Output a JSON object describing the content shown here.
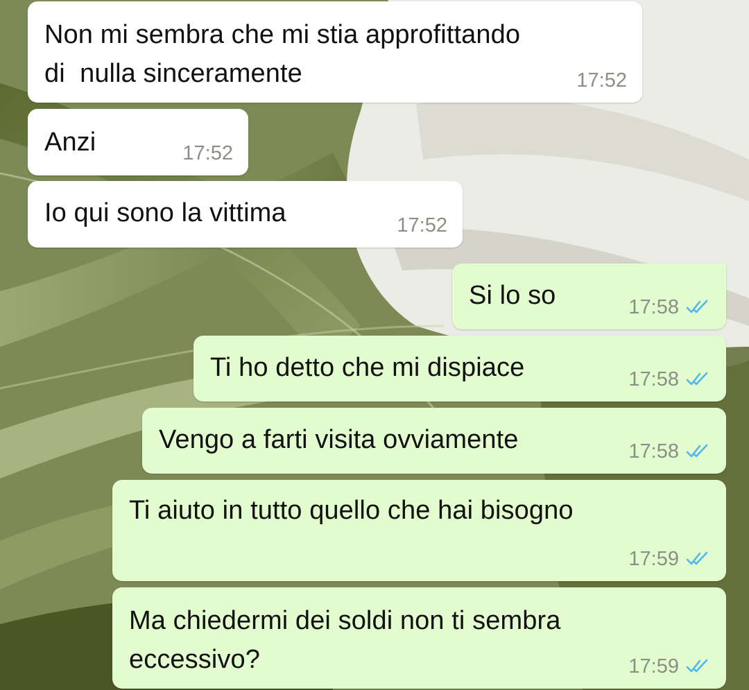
{
  "chat": {
    "messages": [
      {
        "direction": "in",
        "lines": "Non mi sembra che mi stia approfittando\ndi  nulla sinceramente",
        "time": "17:52"
      },
      {
        "direction": "in",
        "lines": "Anzi",
        "time": "17:52"
      },
      {
        "direction": "in",
        "lines": "Io qui sono la vittima",
        "time": "17:52"
      },
      {
        "direction": "out",
        "lines": "Si lo so",
        "time": "17:58",
        "status": "read"
      },
      {
        "direction": "out",
        "lines": "Ti ho detto che mi dispiace",
        "time": "17:58",
        "status": "read"
      },
      {
        "direction": "out",
        "lines": "Vengo a farti visita ovviamente",
        "time": "17:58",
        "status": "read"
      },
      {
        "direction": "out",
        "lines": "Ti aiuto in tutto quello che hai bisogno",
        "time": "17:59",
        "status": "read"
      },
      {
        "direction": "out",
        "lines": "Ma chiedermi dei soldi non ti sembra\neccessivo?",
        "time": "17:59",
        "status": "read"
      }
    ]
  },
  "colors": {
    "incoming_bubble": "#ffffff",
    "outgoing_bubble": "#e3fccf",
    "read_tick": "#4fb6ec",
    "timestamp": "#8a8f86"
  },
  "icons": {
    "read_status": "double-check-icon"
  }
}
